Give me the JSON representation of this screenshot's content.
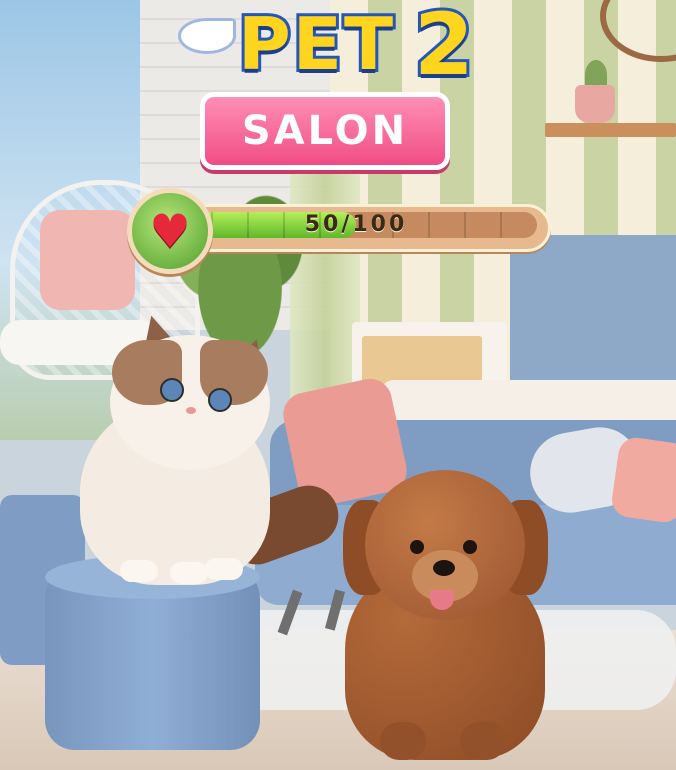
{
  "game": {
    "logo": {
      "title_word": "PET",
      "title_number": "2",
      "subtitle": "SALON"
    },
    "affection_meter": {
      "icon": "heart-icon",
      "current": 50,
      "max": 100,
      "label": "50/100",
      "fill_fraction": 0.5,
      "colors": {
        "fill": "#5fb82a",
        "track": "#c58a5f",
        "heart": "#e5283a"
      }
    },
    "pets": [
      "cat",
      "poodle"
    ]
  }
}
